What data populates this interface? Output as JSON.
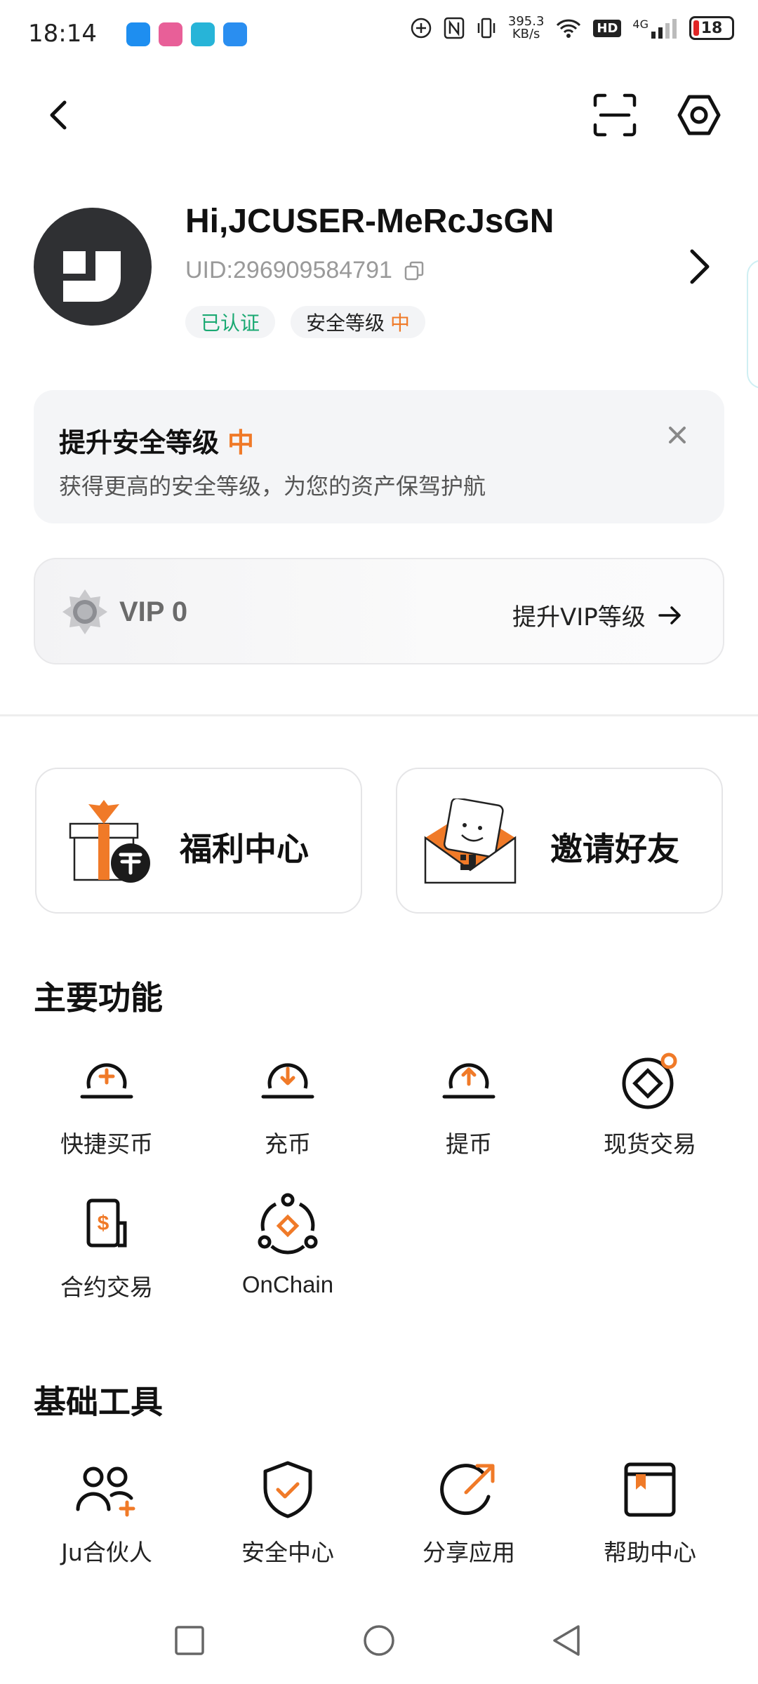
{
  "status_bar": {
    "time": "18:14",
    "net_speed_value": "395.3",
    "net_speed_unit": "KB/s",
    "hd": "HD",
    "network": "4G",
    "battery": "18"
  },
  "profile": {
    "greeting": "Hi,JCUSER-MeRcJsGN",
    "uid": "UID:296909584791",
    "verified": "已认证",
    "security_label": "安全等级",
    "security_level": "中"
  },
  "security_card": {
    "title": "提升安全等级",
    "level": "中",
    "desc": "获得更高的安全等级，为您的资产保驾护航"
  },
  "vip": {
    "label": "VIP 0",
    "upgrade": "提升VIP等级"
  },
  "promos": {
    "welfare": "福利中心",
    "invite": "邀请好友"
  },
  "main_functions": {
    "title": "主要功能",
    "items": [
      "快捷买币",
      "充币",
      "提币",
      "现货交易",
      "合约交易",
      "OnChain"
    ]
  },
  "basic_tools": {
    "title": "基础工具",
    "items": [
      "Ju合伙人",
      "安全中心",
      "分享应用",
      "帮助中心"
    ]
  },
  "colors": {
    "accent": "#f07a28",
    "verified": "#1aa972",
    "dark": "#1f1f1f"
  }
}
